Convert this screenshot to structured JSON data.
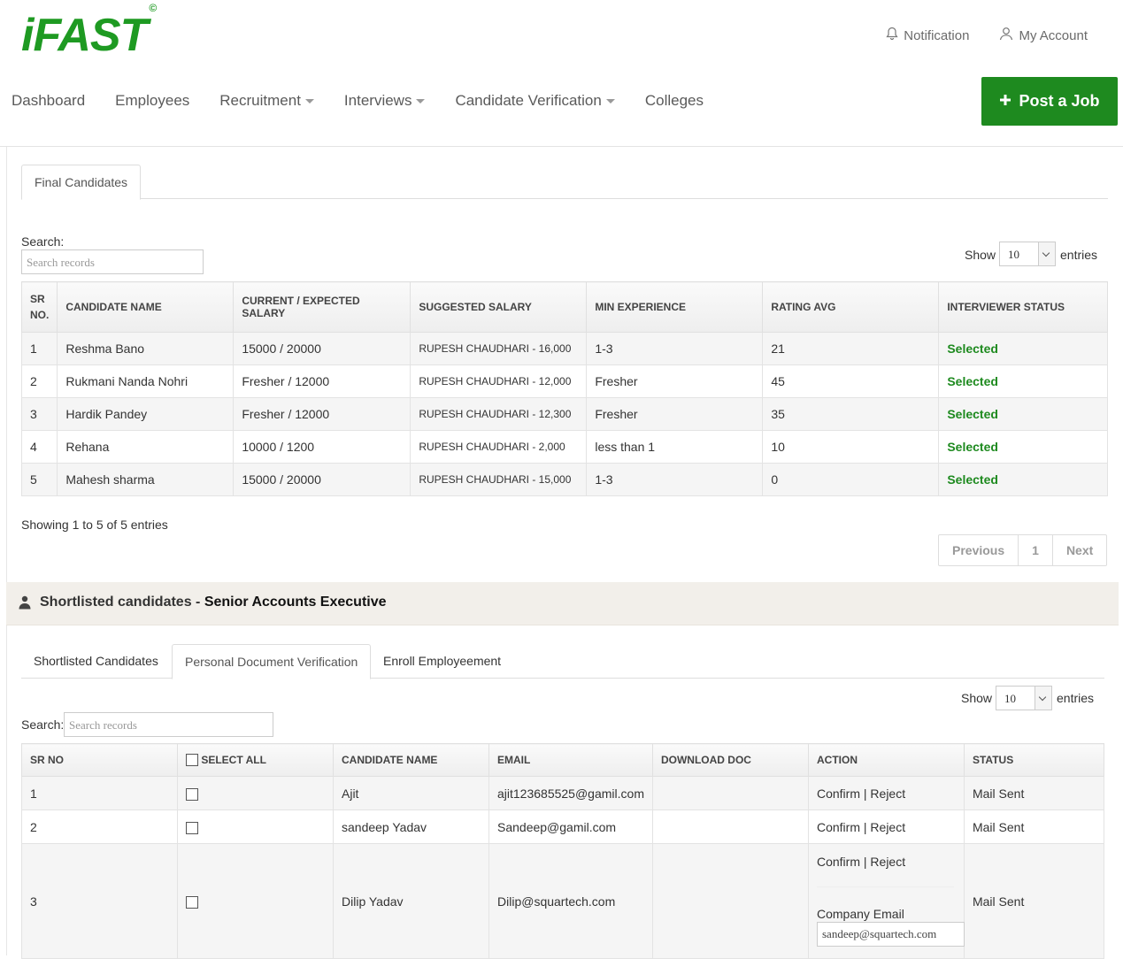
{
  "header": {
    "logo_text": "iFAST",
    "logo_mark": "©",
    "notification_label": "Notification",
    "account_label": "My Account",
    "post_job_label": "Post a Job"
  },
  "nav": {
    "items": [
      {
        "label": "Dashboard",
        "dropdown": false
      },
      {
        "label": "Employees",
        "dropdown": false
      },
      {
        "label": "Recruitment",
        "dropdown": true
      },
      {
        "label": "Interviews",
        "dropdown": true
      },
      {
        "label": "Candidate Verification",
        "dropdown": true
      },
      {
        "label": "Colleges",
        "dropdown": false
      }
    ]
  },
  "final": {
    "tab_label": "Final Candidates",
    "search_label": "Search:",
    "search_placeholder": "Search records",
    "show_label": "Show",
    "show_value": "10",
    "entries_label": "entries",
    "columns": [
      "SR NO.",
      "CANDIDATE NAME",
      "CURRENT / EXPECTED SALARY",
      "SUGGESTED SALARY",
      "MIN EXPERIENCE",
      "RATING AVG",
      "INTERVIEWER STATUS"
    ],
    "rows": [
      {
        "sr": "1",
        "name": "Reshma Bano",
        "salary": "15000 / 20000",
        "suggested": "RUPESH CHAUDHARI - 16,000",
        "exp": "1-3",
        "rating": "21",
        "status": "Selected"
      },
      {
        "sr": "2",
        "name": "Rukmani Nanda Nohri",
        "salary": "Fresher / 12000",
        "suggested": "RUPESH CHAUDHARI - 12,000",
        "exp": "Fresher",
        "rating": "45",
        "status": "Selected"
      },
      {
        "sr": "3",
        "name": "Hardik Pandey",
        "salary": "Fresher / 12000",
        "suggested": "RUPESH CHAUDHARI - 12,300",
        "exp": "Fresher",
        "rating": "35",
        "status": "Selected"
      },
      {
        "sr": "4",
        "name": "Rehana",
        "salary": "10000 / 1200",
        "suggested": "RUPESH CHAUDHARI - 2,000",
        "exp": "less than 1",
        "rating": "10",
        "status": "Selected"
      },
      {
        "sr": "5",
        "name": "Mahesh sharma",
        "salary": "15000 / 20000",
        "suggested": "RUPESH CHAUDHARI - 15,000",
        "exp": "1-3",
        "rating": "0",
        "status": "Selected"
      }
    ],
    "info": "Showing 1 to 5 of 5 entries",
    "pager": {
      "prev": "Previous",
      "page": "1",
      "next": "Next"
    }
  },
  "shortlist": {
    "title_prefix": "Shortlisted candidates - ",
    "title_job": "Senior Accounts Executive",
    "tabs": [
      "Shortlisted Candidates",
      "Personal Document Verification",
      "Enroll Employeement"
    ],
    "active_tab": 1,
    "show_label": "Show",
    "show_value": "10",
    "entries_label": "entries",
    "search_label": "Search:",
    "search_placeholder": "Search records",
    "columns": [
      "SR NO",
      "SELECT ALL",
      "CANDIDATE NAME",
      "EMAIL",
      "DOWNLOAD DOC",
      "ACTION",
      "STATUS"
    ],
    "rows": [
      {
        "sr": "1",
        "name": "Ajit",
        "email": "ajit123685525@gamil.com",
        "confirm": "Confirm",
        "sep": "|",
        "reject": "Reject",
        "status": "Mail Sent"
      },
      {
        "sr": "2",
        "name": "sandeep Yadav",
        "email": "Sandeep@gamil.com",
        "confirm": "Confirm",
        "sep": "|",
        "reject": "Reject",
        "status": "Mail Sent"
      },
      {
        "sr": "3",
        "name": "Dilip Yadav",
        "email": "Dilip@squartech.com",
        "confirm": "Confirm",
        "sep": "|",
        "reject": "Reject",
        "status": "Mail Sent",
        "company_email_label": "Company Email",
        "company_email_value": "sandeep@squartech.com"
      }
    ]
  },
  "colors": {
    "brand": "#1e9a22",
    "button": "#1e8a1f",
    "selected": "#1e8a1f"
  }
}
